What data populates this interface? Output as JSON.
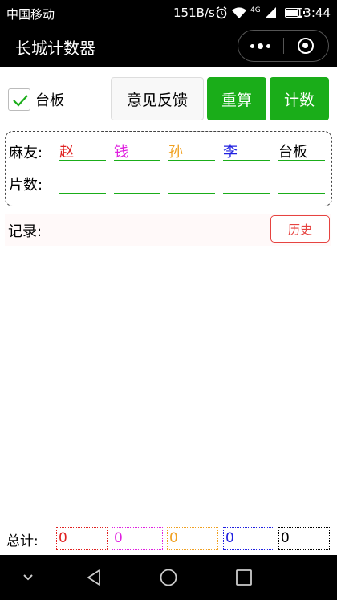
{
  "status_bar": {
    "carrier": "中国移动",
    "speed": "151B/s",
    "network": "4G",
    "time": "13:44"
  },
  "nav": {
    "title": "长城计数器"
  },
  "controls": {
    "checkbox_label": "台板",
    "checked": true,
    "feedback_label": "意见反馈",
    "reset_label": "重算",
    "count_label": "计数"
  },
  "players": {
    "friends_label": "麻友:",
    "pieces_label": "片数:",
    "names": [
      {
        "name": "赵",
        "color": "#e02020"
      },
      {
        "name": "钱",
        "color": "#e020e0"
      },
      {
        "name": "孙",
        "color": "#f0a020"
      },
      {
        "name": "李",
        "color": "#2020e0"
      },
      {
        "name": "台板",
        "color": "#000000"
      }
    ]
  },
  "record": {
    "label": "记录:",
    "history_label": "历史"
  },
  "totals": {
    "label": "总计:",
    "values": [
      {
        "value": "0",
        "color": "#e02020"
      },
      {
        "value": "0",
        "color": "#e020e0"
      },
      {
        "value": "0",
        "color": "#f0a020"
      },
      {
        "value": "0",
        "color": "#2020e0"
      },
      {
        "value": "0",
        "color": "#000000"
      }
    ]
  },
  "colors": {
    "accent": "#1aad19",
    "danger": "#e64340"
  }
}
